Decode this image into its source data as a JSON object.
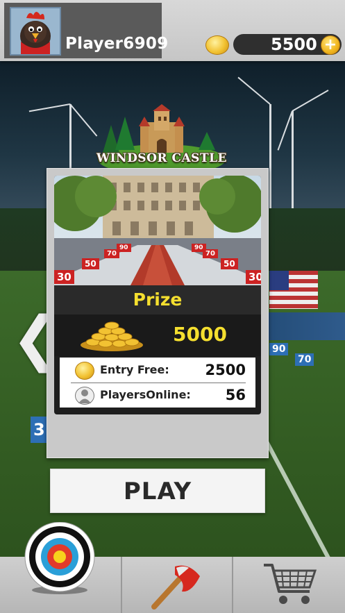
{
  "player": {
    "name": "Player6909",
    "avatar_icon": "rooster-avatar"
  },
  "wallet": {
    "coins": "5500",
    "coin_icon": "gold-coin-icon",
    "add_button_icon": "plus-icon"
  },
  "venue": {
    "title": "WINDSOR CASTLE",
    "lane_markers": [
      "30",
      "50",
      "70",
      "90",
      "90",
      "70",
      "50",
      "30"
    ]
  },
  "prize": {
    "label": "Prize",
    "amount": "5000"
  },
  "details": {
    "entry_label": "Entry Free:",
    "entry_value": "2500",
    "players_label": "PlayersOnline:",
    "players_value": "56"
  },
  "actions": {
    "play_label": "PLAY",
    "prev_icon": "chevron-left-icon"
  },
  "bottom_nav": {
    "items": [
      "target-icon",
      "axe-icon",
      "shopping-cart-icon"
    ]
  },
  "background": {
    "markers": [
      "90",
      "70",
      "3"
    ]
  },
  "colors": {
    "prize_yellow": "#f5df2f",
    "topbar": "#d0d0d0",
    "card": "#c9c9c9"
  }
}
